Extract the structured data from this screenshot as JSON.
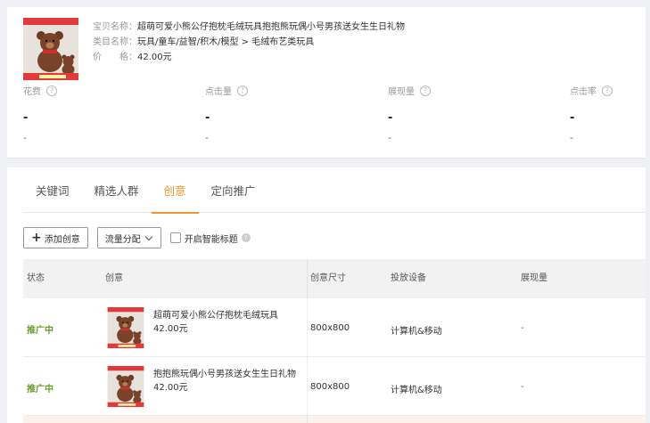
{
  "product": {
    "title_label": "宝贝名称：",
    "title": "超萌可爱小熊公仔抱枕毛绒玩具抱抱熊玩偶小号男孩送女生生日礼物",
    "category_label": "类目名称：",
    "category": "玩具/童车/益智/积木/模型 > 毛绒布艺类玩具",
    "price_label": "价　　格：",
    "price": "42.00元"
  },
  "metrics": [
    {
      "label": "花费",
      "value": "-",
      "sub": "-"
    },
    {
      "label": "点击量",
      "value": "-",
      "sub": "-"
    },
    {
      "label": "展现量",
      "value": "-",
      "sub": "-"
    },
    {
      "label": "点击率",
      "value": "-",
      "sub": "-"
    }
  ],
  "tabs": [
    {
      "label": "关键词",
      "active": false
    },
    {
      "label": "精选人群",
      "active": false
    },
    {
      "label": "创意",
      "active": true
    },
    {
      "label": "定向推广",
      "active": false
    }
  ],
  "toolbar": {
    "add_label": "添加创意",
    "traffic_label": "流量分配",
    "smart_title_label": "开启智能标题"
  },
  "table": {
    "headers": [
      "状态",
      "创意",
      "创意尺寸",
      "投放设备",
      "展现量"
    ],
    "rows": [
      {
        "status": "推广中",
        "title": "超萌可爱小熊公仔抱枕毛绒玩具",
        "price": "42.00元",
        "size": "800x800",
        "device": "计算机&移动",
        "impressions": "-"
      },
      {
        "status": "推广中",
        "title": "抱抱熊玩偶小号男孩送女生生日礼物",
        "price": "42.00元",
        "size": "800x800",
        "device": "计算机&移动",
        "impressions": "-"
      }
    ]
  },
  "colors": {
    "accent": "#f0962f",
    "status_active": "#6a9e2a"
  },
  "icons": {
    "help": "question-circle-icon",
    "add": "plus-icon",
    "dropdown": "chevron-down-icon",
    "info": "info-circle-icon"
  }
}
